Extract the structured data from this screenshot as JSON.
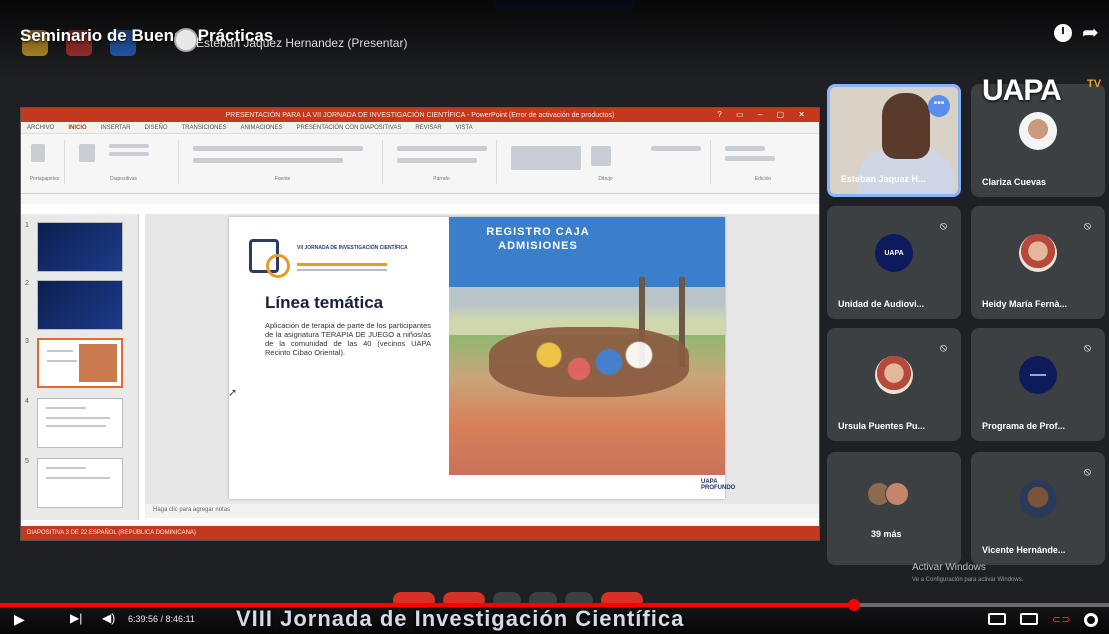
{
  "video": {
    "title": "Seminario de Buenas Prácticas",
    "presenting": "Esteban Jaquez Hernandez (Presentar)",
    "chapter": "VIII Jornada de Investigación Científica",
    "current_time": "6:39:56 / 8:46:11",
    "progress_pct": 77
  },
  "brand": {
    "logo": "UAPA",
    "logo_suffix": "TV"
  },
  "powerpoint": {
    "titlebar": "PRESENTACIÓN PARA LA VII JORNADA DE INVESTIGACIÓN CIENTÍFICA - PowerPoint (Error de activación de productos)",
    "tabs": [
      "ARCHIVO",
      "INICIO",
      "INSERTAR",
      "DISEÑO",
      "TRANSICIONES",
      "ANIMACIONES",
      "PRESENTACIÓN CON DIAPOSITIVAS",
      "REVISAR",
      "VISTA"
    ],
    "ribbon_groups": [
      "Portapapeles",
      "Diapositivas",
      "Fuente",
      "Párrafo",
      "Dibujo",
      "Edición"
    ],
    "thumb_numbers": [
      "1",
      "2",
      "3",
      "4",
      "5"
    ],
    "notes_placeholder": "Haga clic para agregar notas",
    "status": "DIAPOSITIVA 3 DE 22    ESPAÑOL (REPÚBLICA DOMINICANA)"
  },
  "slide": {
    "event": "VII JORNADA DE INVESTIGACIÓN CIENTÍFICA",
    "heading": "Línea temática",
    "body": "Aplicación de terapia de parte de los participantes de la asignatura TERAPIA DE JUEGO a niños/as de la comunidad de las 40 (vecinos UAPA Recinto Cibao Oriental).",
    "sign_text": "REGISTRO CAJA ADMISIONES",
    "footer": "UAPA PROFUNDO"
  },
  "participants": [
    {
      "name": "Esteban Jaquez H...",
      "kind": "self"
    },
    {
      "name": "Clariza Cuevas",
      "kind": "photo2"
    },
    {
      "name": "Unidad de Audiovi...",
      "kind": "uapa"
    },
    {
      "name": "Heidy María Fernà...",
      "kind": "photo4"
    },
    {
      "name": "Ursula Puentes Pu...",
      "kind": "photo4"
    },
    {
      "name": "Programa de Prof...",
      "kind": "prog"
    },
    {
      "name": "39 más",
      "kind": "more"
    },
    {
      "name": "Vicente Hernánde...",
      "kind": "photo3"
    }
  ],
  "windows": {
    "activate_title": "Activar Windows",
    "activate_sub": "Ve a Configuración para activar Windows."
  },
  "icons": {
    "mute": "mic-off-icon",
    "play": "play-icon",
    "next": "next-icon",
    "volume": "volume-icon",
    "captions": "captions-icon",
    "settings": "gear-icon"
  }
}
